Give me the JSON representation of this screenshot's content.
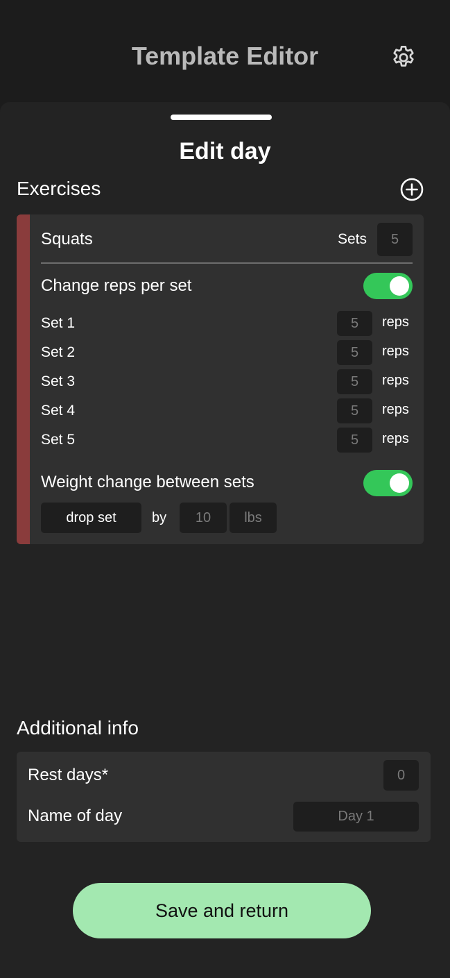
{
  "header": {
    "title": "Template Editor",
    "settings_icon": "gear-icon"
  },
  "sheet": {
    "title": "Edit day",
    "exercises_label": "Exercises",
    "add_icon": "plus-circle-icon"
  },
  "exercise": {
    "name": "Squats",
    "sets_label": "Sets",
    "sets_value": "5",
    "stripe_color": "#8a3c3c",
    "change_reps_label": "Change reps per set",
    "change_reps_on": true,
    "sets": [
      {
        "label": "Set 1",
        "reps": "5",
        "unit": "reps"
      },
      {
        "label": "Set 2",
        "reps": "5",
        "unit": "reps"
      },
      {
        "label": "Set 3",
        "reps": "5",
        "unit": "reps"
      },
      {
        "label": "Set 4",
        "reps": "5",
        "unit": "reps"
      },
      {
        "label": "Set 5",
        "reps": "5",
        "unit": "reps"
      }
    ],
    "weight_change_label": "Weight change between sets",
    "weight_change_on": true,
    "weight_mode": "drop set",
    "by_label": "by",
    "weight_amount": "10",
    "weight_unit": "lbs"
  },
  "additional": {
    "title": "Additional info",
    "rest_days_label": "Rest days*",
    "rest_days_value": "0",
    "name_of_day_label": "Name of day",
    "name_of_day_value": "Day 1"
  },
  "save_button": "Save and return",
  "colors": {
    "toggle_on": "#34c759",
    "save_button": "#a3e8b0",
    "background": "#1c1c1c"
  }
}
